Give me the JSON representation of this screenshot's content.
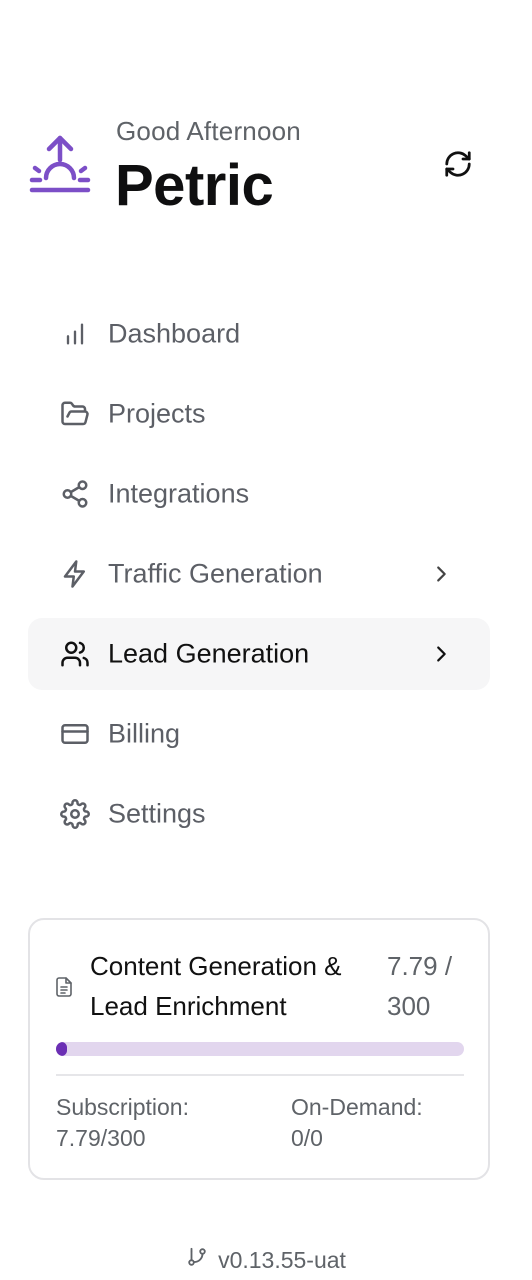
{
  "header": {
    "greeting": "Good Afternoon",
    "username": "Petric",
    "logo_icon": "sunrise-icon",
    "refresh_icon": "refresh-icon",
    "brand_color": "#7c4fc7"
  },
  "nav": {
    "items": [
      {
        "label": "Dashboard",
        "icon": "bar-chart-icon",
        "has_chevron": false,
        "active": false
      },
      {
        "label": "Projects",
        "icon": "folder-open-icon",
        "has_chevron": false,
        "active": false
      },
      {
        "label": "Integrations",
        "icon": "share-icon",
        "has_chevron": false,
        "active": false
      },
      {
        "label": "Traffic Generation",
        "icon": "lightning-icon",
        "has_chevron": true,
        "active": false
      },
      {
        "label": "Lead Generation",
        "icon": "users-icon",
        "has_chevron": true,
        "active": true
      },
      {
        "label": "Billing",
        "icon": "credit-card-icon",
        "has_chevron": false,
        "active": false
      },
      {
        "label": "Settings",
        "icon": "gear-icon",
        "has_chevron": false,
        "active": false
      }
    ]
  },
  "usage": {
    "title": "Content Generation & Lead Enrichment",
    "value": "7.79 / 300",
    "progress_fraction": 0.026,
    "progress_color": "#6b2fb4",
    "track_color": "#e2d6ee",
    "subscription_label": "Subscription:",
    "subscription_value": "7.79/300",
    "on_demand_label": "On-Demand:",
    "on_demand_value": "0/0",
    "doc_icon": "document-icon"
  },
  "footer": {
    "version": "v0.13.55-uat",
    "version_icon": "git-branch-icon"
  }
}
